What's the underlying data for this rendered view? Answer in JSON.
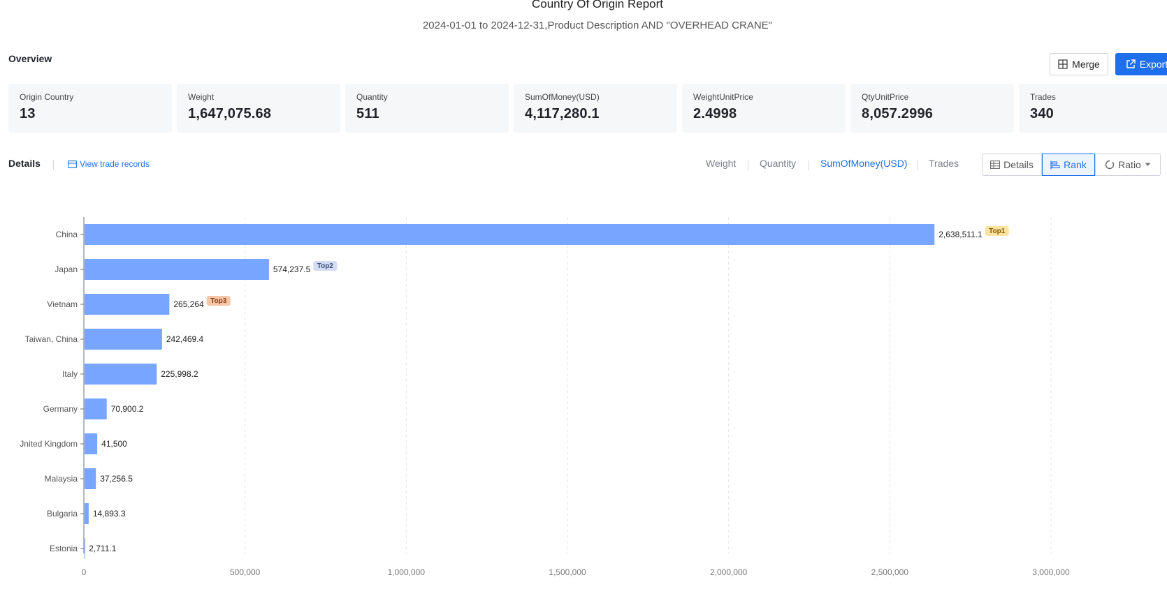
{
  "report": {
    "title": "Country Of Origin Report",
    "subtitle": "2024-01-01 to 2024-12-31,Product Description AND \"OVERHEAD CRANE\""
  },
  "overview": {
    "label": "Overview",
    "merge_label": "Merge",
    "export_label": "Export"
  },
  "stats": [
    {
      "label": "Origin Country",
      "value": "13"
    },
    {
      "label": "Weight",
      "value": "1,647,075.68"
    },
    {
      "label": "Quantity",
      "value": "511"
    },
    {
      "label": "SumOfMoney(USD)",
      "value": "4,117,280.1"
    },
    {
      "label": "WeightUnitPrice",
      "value": "2.4998"
    },
    {
      "label": "QtyUnitPrice",
      "value": "8,057.2996"
    },
    {
      "label": "Trades",
      "value": "340"
    }
  ],
  "details": {
    "label": "Details",
    "view_records": "View trade records",
    "metric_tabs": [
      "Weight",
      "Quantity",
      "SumOfMoney(USD)",
      "Trades"
    ],
    "active_metric": "SumOfMoney(USD)",
    "view_buttons": [
      "Details",
      "Rank",
      "Ratio"
    ],
    "active_view": "Rank"
  },
  "colors": {
    "accent": "#1f6fec",
    "bar": "#77a5ff",
    "top1_bg": "#fbe3a1",
    "top1_fg": "#8a5a00",
    "top2_bg": "#d3dcf2",
    "top2_fg": "#3d4f7a",
    "top3_bg": "#f5c6a8",
    "top3_fg": "#8a3d12"
  },
  "chart_data": {
    "type": "bar",
    "orientation": "horizontal",
    "categories": [
      "China",
      "Japan",
      "Vietnam",
      "Taiwan, China",
      "Italy",
      "Germany",
      "Jnited Kingdom",
      "Malaysia",
      "Bulgaria",
      "Estonia"
    ],
    "values": [
      2638511.1,
      574237.5,
      265264,
      242469.4,
      225998.2,
      70900.2,
      41500,
      37256.5,
      14893.3,
      2711.1
    ],
    "value_labels": [
      "2,638,511.1",
      "574,237.5",
      "265,264",
      "242,469.4",
      "225,998.2",
      "70,900.2",
      "41,500",
      "37,256.5",
      "14,893.3",
      "2,711.1"
    ],
    "rank_badges": [
      "Top1",
      "Top2",
      "Top3"
    ],
    "xlim": [
      0,
      3000000
    ],
    "x_ticks": [
      0,
      500000,
      1000000,
      1500000,
      2000000,
      2500000,
      3000000
    ],
    "x_tick_labels": [
      "0",
      "500,000",
      "1,000,000",
      "1,500,000",
      "2,000,000",
      "2,500,000",
      "3,000,000"
    ],
    "grid": true
  }
}
